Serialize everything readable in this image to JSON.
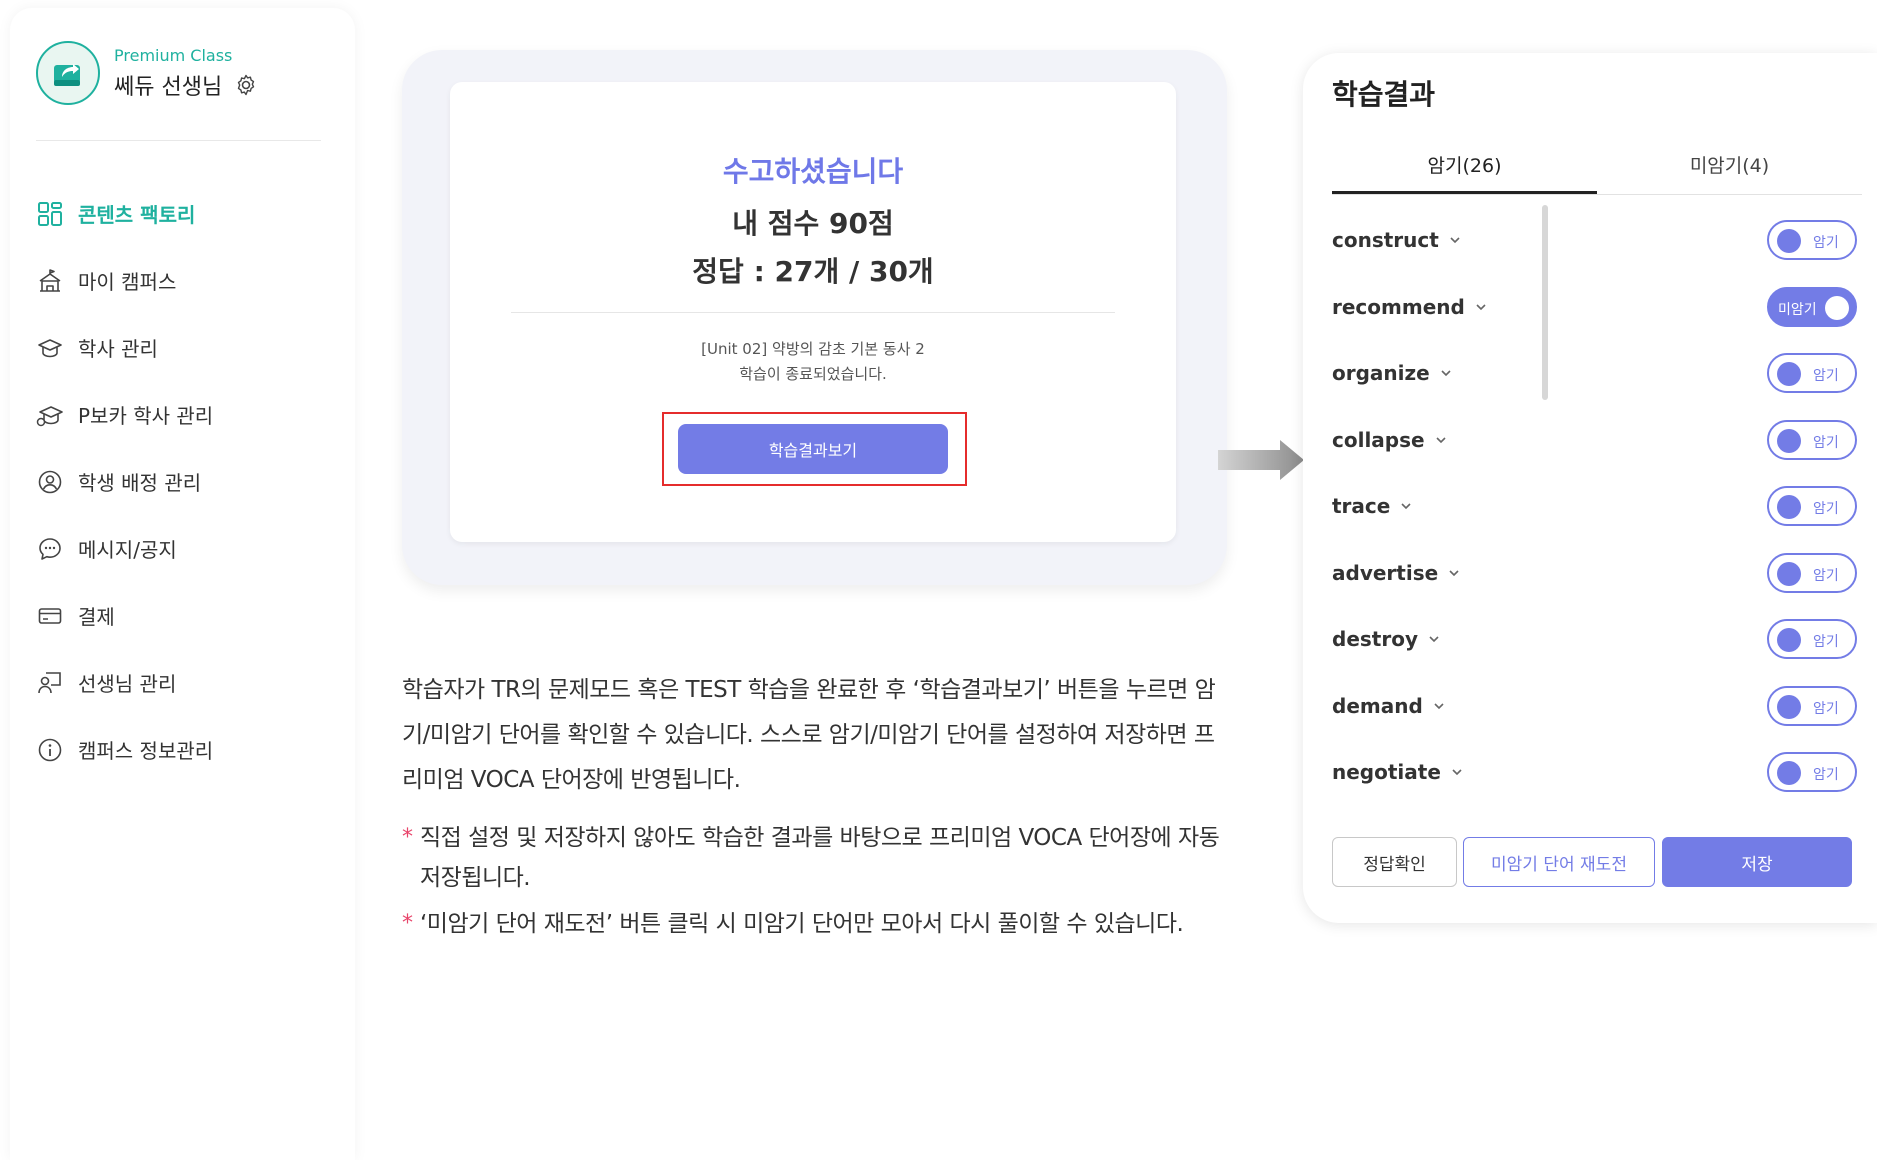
{
  "sidebar": {
    "premium_label": "Premium Class",
    "teacher_name": "쎄듀 선생님",
    "items": [
      {
        "label": "콘텐츠 팩토리",
        "icon": "content-factory-icon",
        "active": true
      },
      {
        "label": "마이 캠퍼스",
        "icon": "campus-icon",
        "active": false
      },
      {
        "label": "학사 관리",
        "icon": "academic-cap-icon",
        "active": false
      },
      {
        "label": "P보카 학사 관리",
        "icon": "pvoca-academic-icon",
        "active": false
      },
      {
        "label": "학생 배정 관리",
        "icon": "student-assign-icon",
        "active": false
      },
      {
        "label": "메시지/공지",
        "icon": "message-icon",
        "active": false
      },
      {
        "label": "결제",
        "icon": "payment-card-icon",
        "active": false
      },
      {
        "label": "선생님 관리",
        "icon": "teacher-icon",
        "active": false
      },
      {
        "label": "캠퍼스 정보관리",
        "icon": "info-icon",
        "active": false
      }
    ]
  },
  "finish": {
    "title": "수고하셨습니다",
    "score": "내 점수 90점",
    "correct": "정답 : 27개 / 30개",
    "unit_line1": "[Unit 02] 약방의 감초 기본 동사 2",
    "unit_line2": "학습이 종료되었습니다.",
    "button_label": "학습결과보기"
  },
  "description": {
    "main": "학습자가 TR의 문제모드 혹은 TEST 학습을 완료한 후 ‘학습결과보기’ 버튼을 누르면 암기/미암기 단어를 확인할 수 있습니다. 스스로 암기/미암기 단어를 설정하여 저장하면 프리미엄 VOCA 단어장에 반영됩니다.",
    "notes": [
      {
        "star": "*",
        "text": "직접 설정 및 저장하지 않아도 학습한 결과를 바탕으로 프리미엄 VOCA 단어장에 자동 저장됩니다."
      },
      {
        "star": "*",
        "text": "‘미암기 단어 재도전’ 버튼 클릭 시 미암기 단어만 모아서 다시 풀이할 수 있습니다."
      }
    ]
  },
  "result": {
    "title": "학습결과",
    "tabs": [
      {
        "label": "암기(26)",
        "active": true
      },
      {
        "label": "미암기(4)",
        "active": false
      }
    ],
    "words": [
      {
        "word": "construct",
        "status": "암기",
        "memorized": true
      },
      {
        "word": "recommend",
        "status": "미암기",
        "memorized": false
      },
      {
        "word": "organize",
        "status": "암기",
        "memorized": true
      },
      {
        "word": "collapse",
        "status": "암기",
        "memorized": true
      },
      {
        "word": "trace",
        "status": "암기",
        "memorized": true
      },
      {
        "word": "advertise",
        "status": "암기",
        "memorized": true
      },
      {
        "word": "destroy",
        "status": "암기",
        "memorized": true
      },
      {
        "word": "demand",
        "status": "암기",
        "memorized": true
      },
      {
        "word": "negotiate",
        "status": "암기",
        "memorized": true
      }
    ],
    "buttons": {
      "check": "정답확인",
      "retry": "미암기 단어 재도전",
      "save": "저장"
    }
  },
  "colors": {
    "brand_teal": "#1fb19f",
    "accent_purple": "#737ce6",
    "highlight_red": "#e52c2c",
    "note_star": "#e8456b"
  }
}
